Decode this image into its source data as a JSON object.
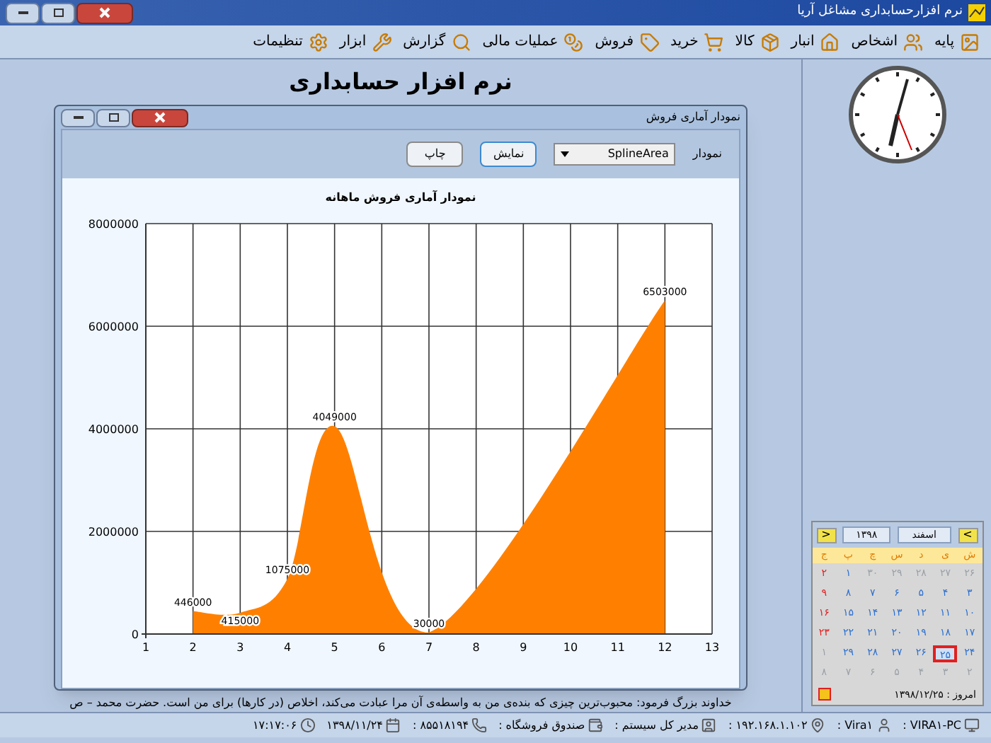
{
  "window": {
    "title": "نرم افزارحسابداری مشاغل آریا"
  },
  "menu": [
    "پایه",
    "اشخاص",
    "انبار",
    "کالا",
    "خرید",
    "فروش",
    "عملیات مالی",
    "گزارش",
    "ابزار",
    "تنظیمات"
  ],
  "heading": "نرم افزار حسابداری",
  "chart_window": {
    "title": "نمودار آماری فروش",
    "chart_label": "نمودار",
    "chart_type": "SplineArea",
    "buttons": [
      "نمایش",
      "چاپ"
    ],
    "chart_data": {
      "type": "area",
      "title": "نمودار آماری فروش ماهانه",
      "x": [
        2,
        3,
        4,
        5,
        7,
        12
      ],
      "series": [
        {
          "color": "#ff8000",
          "values": [
            446000,
            415000,
            1075000,
            4049000,
            30000,
            6503000
          ]
        }
      ],
      "xlim": [
        1,
        13
      ],
      "ylim": [
        0,
        8000000
      ],
      "xticks": [
        1,
        2,
        3,
        4,
        5,
        6,
        7,
        8,
        9,
        10,
        11,
        12,
        13
      ],
      "yticks": [
        0,
        2000000,
        4000000,
        6000000,
        8000000
      ],
      "data_labels": true,
      "grid": true
    }
  },
  "quote": "خداوند بزرگ فرمود: محبوب‌ترین چیزی که بنده‌ی من به واسطه‌ی آن مرا عبادت می‌کند، اخلاص (در کارها) برای من است.  حضرت محمد – ص",
  "calendar": {
    "month": "اسفند",
    "year": "۱۳۹۸",
    "prev": "<",
    "next": ">",
    "weekdays": [
      "ش",
      "ی",
      "د",
      "س",
      "چ",
      "پ",
      "ج"
    ],
    "weeks": [
      [
        {
          "day": "۲۶",
          "kind": "other",
          "selected": false
        },
        {
          "day": "۲۷",
          "kind": "other",
          "selected": false
        },
        {
          "day": "۲۸",
          "kind": "other",
          "selected": false
        },
        {
          "day": "۲۹",
          "kind": "other",
          "selected": false
        },
        {
          "day": "۳۰",
          "kind": "other",
          "selected": false
        },
        {
          "day": "۱",
          "kind": "current",
          "selected": false
        },
        {
          "day": "۲",
          "kind": "holiday",
          "selected": false
        }
      ],
      [
        {
          "day": "۳",
          "kind": "current",
          "selected": false
        },
        {
          "day": "۴",
          "kind": "current",
          "selected": false
        },
        {
          "day": "۵",
          "kind": "current",
          "selected": false
        },
        {
          "day": "۶",
          "kind": "current",
          "selected": false
        },
        {
          "day": "۷",
          "kind": "current",
          "selected": false
        },
        {
          "day": "۸",
          "kind": "current",
          "selected": false
        },
        {
          "day": "۹",
          "kind": "holiday",
          "selected": false
        }
      ],
      [
        {
          "day": "۱۰",
          "kind": "current",
          "selected": false
        },
        {
          "day": "۱۱",
          "kind": "current",
          "selected": false
        },
        {
          "day": "۱۲",
          "kind": "current",
          "selected": false
        },
        {
          "day": "۱۳",
          "kind": "current",
          "selected": false
        },
        {
          "day": "۱۴",
          "kind": "current",
          "selected": false
        },
        {
          "day": "۱۵",
          "kind": "current",
          "selected": false
        },
        {
          "day": "۱۶",
          "kind": "holiday",
          "selected": false
        }
      ],
      [
        {
          "day": "۱۷",
          "kind": "current",
          "selected": false
        },
        {
          "day": "۱۸",
          "kind": "current",
          "selected": false
        },
        {
          "day": "۱۹",
          "kind": "current",
          "selected": false
        },
        {
          "day": "۲۰",
          "kind": "current",
          "selected": false
        },
        {
          "day": "۲۱",
          "kind": "current",
          "selected": false
        },
        {
          "day": "۲۲",
          "kind": "current",
          "selected": false
        },
        {
          "day": "۲۳",
          "kind": "holiday",
          "selected": false
        }
      ],
      [
        {
          "day": "۲۴",
          "kind": "current",
          "selected": false
        },
        {
          "day": "۲۵",
          "kind": "current",
          "selected": true
        },
        {
          "day": "۲۶",
          "kind": "current",
          "selected": false
        },
        {
          "day": "۲۷",
          "kind": "current",
          "selected": false
        },
        {
          "day": "۲۸",
          "kind": "current",
          "selected": false
        },
        {
          "day": "۲۹",
          "kind": "current",
          "selected": false
        },
        {
          "day": "۱",
          "kind": "other",
          "selected": false
        }
      ],
      [
        {
          "day": "۲",
          "kind": "other",
          "selected": false
        },
        {
          "day": "۳",
          "kind": "other",
          "selected": false
        },
        {
          "day": "۴",
          "kind": "other",
          "selected": false
        },
        {
          "day": "۵",
          "kind": "other",
          "selected": false
        },
        {
          "day": "۶",
          "kind": "other",
          "selected": false
        },
        {
          "day": "۷",
          "kind": "other",
          "selected": false
        },
        {
          "day": "۸",
          "kind": "other",
          "selected": false
        }
      ]
    ],
    "today": "امروز : ۱۳۹۸/۱۲/۲۵"
  },
  "status_bar": [
    "VIRA۱-PC :",
    "Vira۱ :",
    "۱۹۲.۱۶۸.۱.۱۰۲ :",
    "مدیر کل سیستم :",
    "صندوق فروشگاه :",
    "۸۵۵۱۸۱۹۴ :",
    "۱۳۹۸/۱۱/۲۴",
    "۱۷:۱۷:۰۶"
  ]
}
